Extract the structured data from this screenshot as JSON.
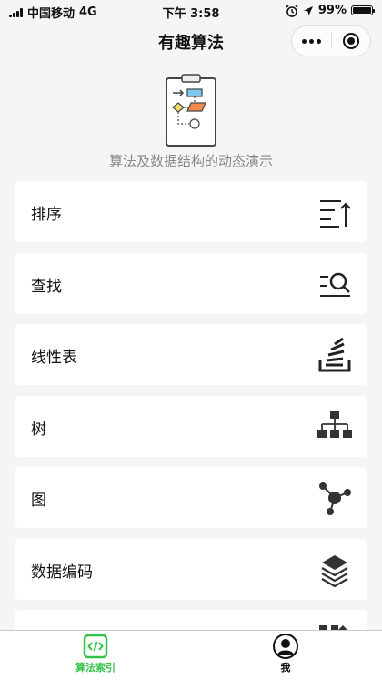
{
  "status_bar": {
    "carrier": "中国移动",
    "network": "4G",
    "time": "下午 3:58",
    "battery": "99%",
    "battery_level": 0.99
  },
  "nav": {
    "title": "有趣算法",
    "more_icon": "more-dots-icon",
    "close_icon": "close-miniprogram-icon"
  },
  "header": {
    "icon": "clipboard-flowchart-icon",
    "subtitle": "算法及数据结构的动态演示"
  },
  "categories": [
    {
      "label": "排序",
      "icon": "sort-ascending-icon"
    },
    {
      "label": "查找",
      "icon": "search-list-icon"
    },
    {
      "label": "线性表",
      "icon": "stack-tray-icon"
    },
    {
      "label": "树",
      "icon": "tree-hierarchy-icon"
    },
    {
      "label": "图",
      "icon": "graph-nodes-icon"
    },
    {
      "label": "数据编码",
      "icon": "layers-icon"
    },
    {
      "label": "",
      "icon": "grid-icon"
    }
  ],
  "tabs": [
    {
      "label": "算法索引",
      "icon": "code-brackets-icon",
      "active": true,
      "color": "#35c24b"
    },
    {
      "label": "我",
      "icon": "user-avatar-icon",
      "active": false,
      "color": "#111111"
    }
  ]
}
